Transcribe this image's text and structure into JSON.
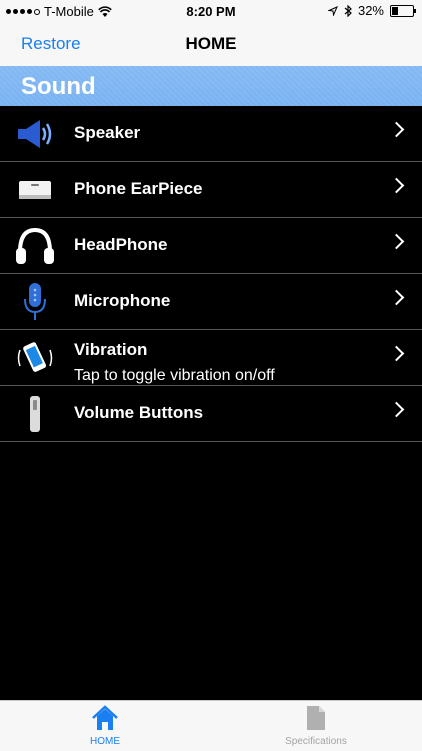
{
  "status": {
    "carrier": "T-Mobile",
    "time": "8:20 PM",
    "battery": "32%",
    "battery_level": 0.32
  },
  "nav": {
    "left": "Restore",
    "title": "HOME"
  },
  "section": {
    "title": "Sound"
  },
  "rows": [
    {
      "label": "Speaker",
      "icon": "speaker-icon"
    },
    {
      "label": "Phone EarPiece",
      "icon": "earpiece-icon"
    },
    {
      "label": "HeadPhone",
      "icon": "headphone-icon"
    },
    {
      "label": "Microphone",
      "icon": "microphone-icon"
    },
    {
      "label": "Vibration",
      "sub": "Tap to toggle vibration on/off",
      "icon": "vibration-icon"
    },
    {
      "label": "Volume Buttons",
      "icon": "volume-buttons-icon"
    }
  ],
  "tabs": [
    {
      "label": "HOME",
      "icon": "home-icon",
      "color": "#1a7ff0"
    },
    {
      "label": "Specifications",
      "icon": "document-icon",
      "color": "#a3a3a3"
    }
  ]
}
